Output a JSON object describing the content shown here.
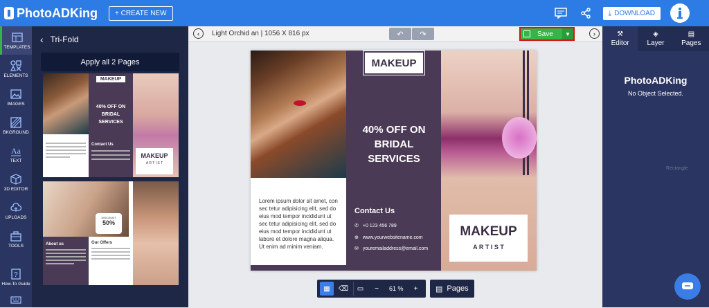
{
  "topbar": {
    "logo": "PhotoADKing",
    "create_label": "+ CREATE NEW",
    "download_label": "DOWNLOAD"
  },
  "leftnav": [
    {
      "label": "TEMPLATES",
      "icon": "templates-icon"
    },
    {
      "label": "ELEMENTS",
      "icon": "elements-icon"
    },
    {
      "label": "IMAGES",
      "icon": "images-icon"
    },
    {
      "label": "BKGROUND",
      "icon": "background-icon"
    },
    {
      "label": "TEXT",
      "icon": "text-icon"
    },
    {
      "label": "3D EDITOR",
      "icon": "cube-icon"
    },
    {
      "label": "UPLOADS",
      "icon": "upload-icon"
    },
    {
      "label": "TOOLS",
      "icon": "tools-icon"
    },
    {
      "label": "How-To Guide",
      "icon": "guide-icon"
    }
  ],
  "panel": {
    "title": "Tri-Fold",
    "apply_label": "Apply all 2 Pages"
  },
  "thumb1": {
    "makeup": "MAKEUP",
    "offer": "40% OFF ON BRIDAL SERVICES",
    "contact": "Contact Us",
    "makeup2": "MAKEUP",
    "artist": "A R T I S T"
  },
  "thumb2": {
    "discount": "DISCOUNT",
    "pct": "50%",
    "about": "About us",
    "offers": "Our Offers"
  },
  "toolbar": {
    "doc_title": "Light Orchid an | 1056 X 816 px",
    "save_label": "Save"
  },
  "canvas": {
    "makeup_label": "MAKEUP",
    "offer": "40% OFF ON BRIDAL SERVICES",
    "body_text": "Lorem ipsum dolor sit amet, con sec tetur adipisicing elit, sed do eius mod tempor incididunt ut sec tetur adipisicing elit, sed do eius mod tempor incididunt ut labore et dolore magna aliqua. Ut enim ad minim veniam.",
    "contact_title": "Contact Us",
    "phone": "+0 123 456 789",
    "website": "www.yourwebsitename.com",
    "email": "youremailaddress@email.com",
    "makeup_big": "MAKEUP",
    "artist": "A R T I S T"
  },
  "bottom": {
    "zoom": "61 %",
    "pages_label": "Pages"
  },
  "rightpanel": {
    "tabs": [
      "Editor",
      "Layer",
      "Pages"
    ],
    "logo": "PhotoADKing",
    "status": "No Object Selected.",
    "hint": "Rectangle"
  },
  "colors": {
    "accent": "#2d7be5",
    "save": "#35b447",
    "dark_panel": "#1f2747",
    "purple": "#4a3a55"
  }
}
